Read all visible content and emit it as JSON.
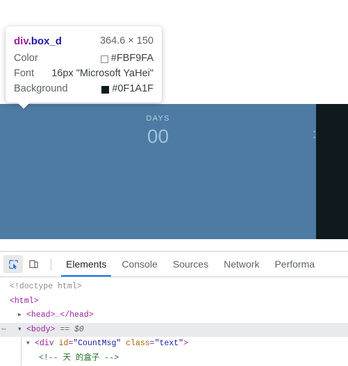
{
  "viewport": {
    "page_background_color": "#0F1A1F",
    "highlight_color": "#4E7BA3",
    "countdown": {
      "days_label": "DAYS",
      "days_value": "00",
      "separator": ":"
    }
  },
  "inspector_tooltip": {
    "element_tag": "div",
    "element_class": ".box_d",
    "dimensions": "364.6 × 150",
    "rows": [
      {
        "key": "Color",
        "value": "#FBF9FA",
        "swatch": "#FBF9FA"
      },
      {
        "key": "Font",
        "value": "16px \"Microsoft YaHei\"",
        "swatch": null
      },
      {
        "key": "Background",
        "value": "#0F1A1F",
        "swatch": "#0F1A1F"
      }
    ]
  },
  "devtools": {
    "toolbar": {
      "inspect_icon": "inspect-element-icon",
      "device_icon": "device-toolbar-icon"
    },
    "tabs": [
      {
        "label": "Elements",
        "selected": true
      },
      {
        "label": "Console",
        "selected": false
      },
      {
        "label": "Sources",
        "selected": false
      },
      {
        "label": "Network",
        "selected": false
      },
      {
        "label": "Performa",
        "selected": false
      }
    ],
    "dom_lines": {
      "doctype": "<!doctype html>",
      "html_open": "<html>",
      "head_collapsed_open": "<head>",
      "head_collapsed_ellipsis": "…",
      "head_collapsed_close": "</head>",
      "body_open": "<body>",
      "body_ref": "== $0",
      "div_open": "<div",
      "div_attr1_name": "id",
      "div_attr1_value": "\"CountMsg\"",
      "div_attr2_name": "class",
      "div_attr2_value": "\"text\"",
      "div_close_bracket": ">",
      "comment": "<!-- 天 的盒子 -->",
      "ellipsis_badge": "⋯"
    }
  }
}
